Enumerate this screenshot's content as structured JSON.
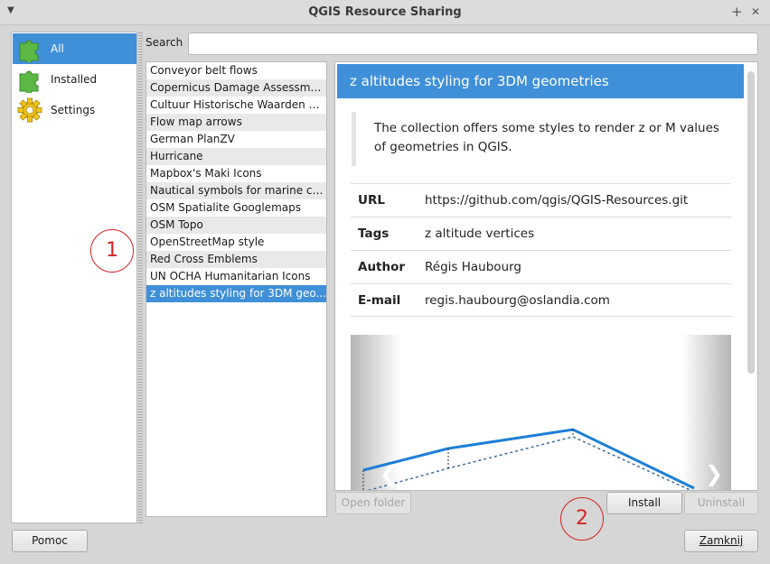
{
  "window": {
    "title": "QGIS Resource Sharing",
    "menu_glyph": "▼",
    "maximize_glyph": "+",
    "close_glyph": "✕"
  },
  "sidebar": {
    "items": [
      {
        "label": "All",
        "icon": "puzzle-icon",
        "selected": true
      },
      {
        "label": "Installed",
        "icon": "puzzle-icon",
        "selected": false
      },
      {
        "label": "Settings",
        "icon": "gear-icon",
        "selected": false
      }
    ]
  },
  "search": {
    "label": "Search",
    "value": ""
  },
  "collections": {
    "items": [
      "Conveyor belt flows",
      "Copernicus Damage Assessment",
      "Cultuur Historische Waarden Ka...",
      "Flow map arrows",
      "German PlanZV",
      "Hurricane",
      "Mapbox's Maki Icons",
      "Nautical symbols for marine cha...",
      "OSM Spatialite Googlemaps",
      "OSM Topo",
      "OpenStreetMap style",
      "Red Cross Emblems",
      "UN OCHA Humanitarian Icons",
      "z altitudes styling for 3DM geo..."
    ],
    "selected_index": 13
  },
  "detail": {
    "title": "z altitudes styling for 3DM geometries",
    "description": "The collection offers some styles to render z or M values of geometries in QGIS.",
    "fields": [
      {
        "key": "URL",
        "value": "https://github.com/qgis/QGIS-Resources.git"
      },
      {
        "key": "Tags",
        "value": "z altitude vertices"
      },
      {
        "key": "Author",
        "value": "Régis Haubourg"
      },
      {
        "key": "E-mail",
        "value": "regis.haubourg@oslandia.com"
      }
    ],
    "prev_glyph": "❮",
    "next_glyph": "❯"
  },
  "buttons": {
    "open_folder": "Open folder",
    "install": "Install",
    "uninstall": "Uninstall",
    "help": "Pomoc",
    "close": "Zamknij"
  },
  "markers": {
    "first": "1",
    "second": "2"
  },
  "colors": {
    "accent": "#3f8fd9",
    "marker": "#d42424"
  }
}
